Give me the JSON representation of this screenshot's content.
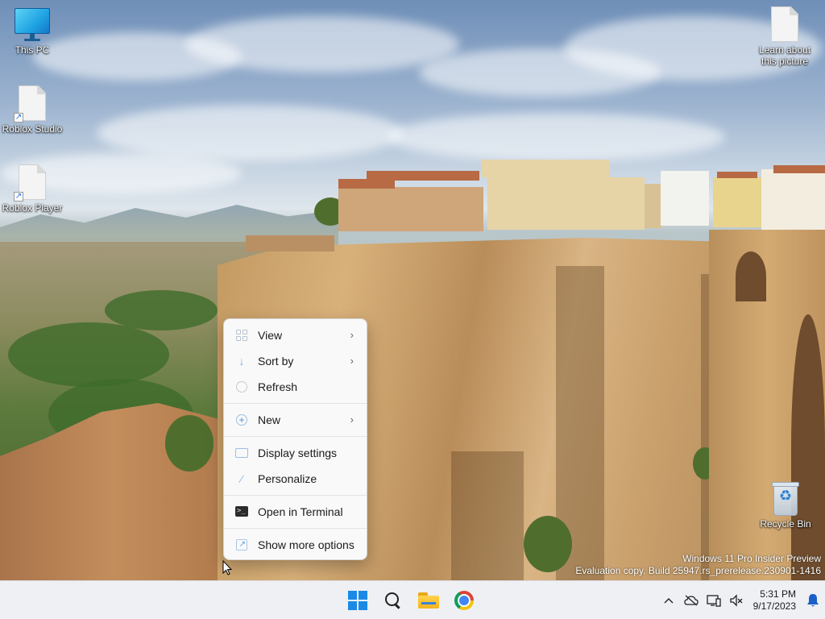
{
  "desktop": {
    "icons": [
      {
        "label": "This PC"
      },
      {
        "label": "Roblox Studio"
      },
      {
        "label": "Roblox Player"
      },
      {
        "label": "Learn about this picture"
      },
      {
        "label": "Recycle Bin"
      }
    ]
  },
  "context_menu": {
    "items": [
      {
        "label": "View",
        "icon": "view-grid-icon",
        "has_submenu": true
      },
      {
        "label": "Sort by",
        "icon": "sort-icon",
        "has_submenu": true
      },
      {
        "label": "Refresh",
        "icon": "refresh-icon",
        "has_submenu": false
      },
      {
        "label": "New",
        "icon": "new-plus-icon",
        "has_submenu": true
      },
      {
        "label": "Display settings",
        "icon": "display-icon",
        "has_submenu": false
      },
      {
        "label": "Personalize",
        "icon": "brush-icon",
        "has_submenu": false
      },
      {
        "label": "Open in Terminal",
        "icon": "terminal-icon",
        "has_submenu": false
      },
      {
        "label": "Show more options",
        "icon": "more-options-icon",
        "has_submenu": false
      }
    ]
  },
  "watermark": {
    "line1": "Windows 11 Pro Insider Preview",
    "line2": "Evaluation copy. Build 25947.rs_prerelease.230901-1416"
  },
  "taskbar": {
    "apps": [
      "start-icon",
      "search-icon",
      "file-explorer-icon",
      "chrome-icon"
    ],
    "tray": {
      "time": "5:31 PM",
      "date": "9/17/2023"
    }
  },
  "colors": {
    "accent": "#1a8ae6",
    "taskbar_bg": "#eef0f4",
    "menu_bg": "#f9f9f9"
  }
}
